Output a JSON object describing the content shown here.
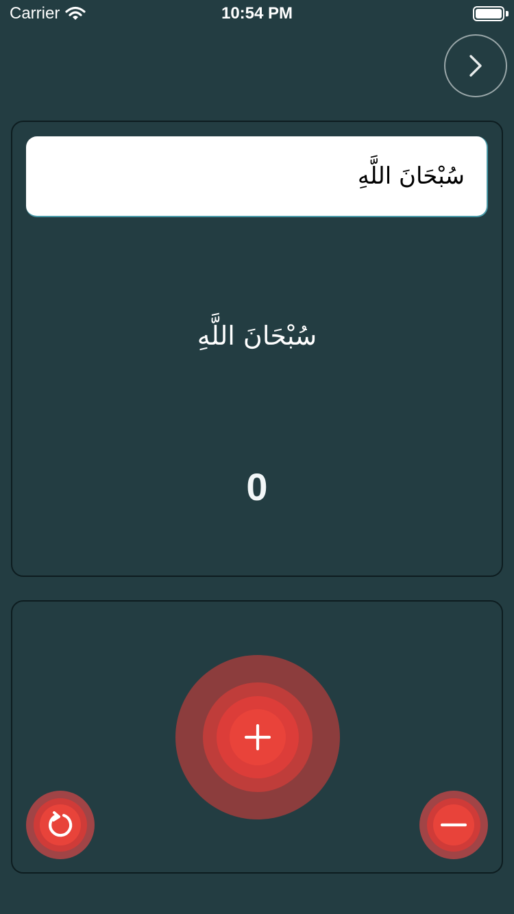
{
  "status_bar": {
    "carrier": "Carrier",
    "time": "10:54 PM"
  },
  "dhikr": {
    "selected": "سُبْحَانَ اللَّهِ",
    "display": "سُبْحَانَ اللَّهِ"
  },
  "counter": {
    "value": "0"
  },
  "icons": {
    "next": "chevron-right-icon",
    "increment": "plus-icon",
    "decrement": "minus-icon",
    "reset": "reset-icon"
  },
  "colors": {
    "background": "#233d42",
    "accent": "#e9433a"
  }
}
